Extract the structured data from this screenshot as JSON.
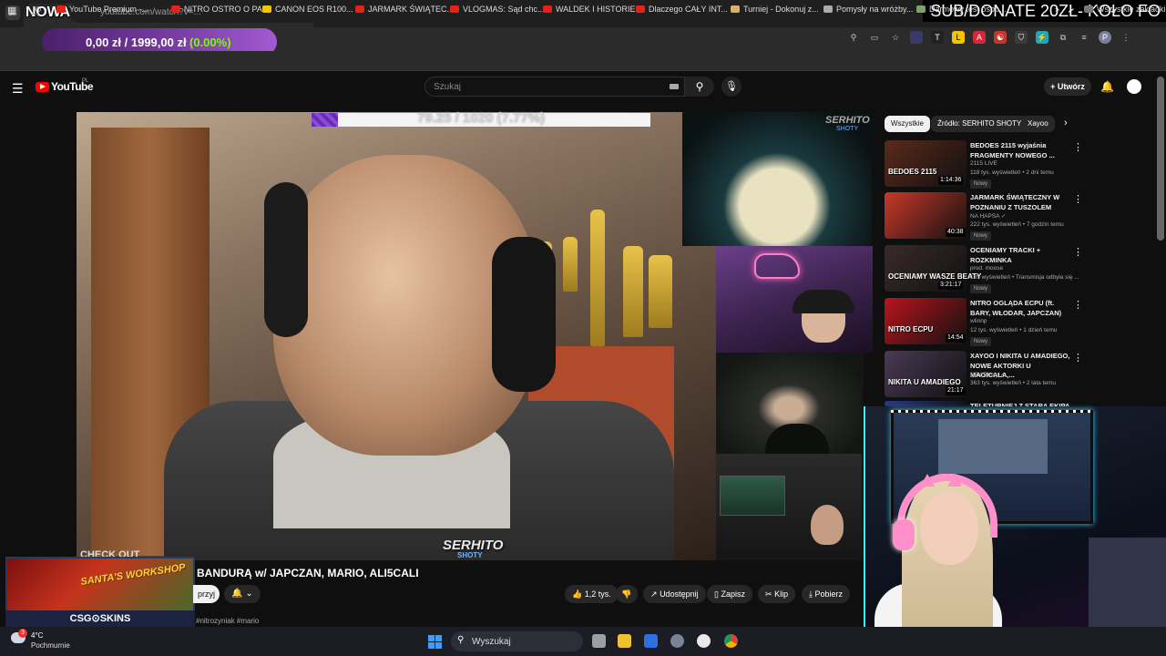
{
  "browser": {
    "tab_title": "NOWA KAMERKA DO STRIMOWANIA",
    "tab_menu": "⌄",
    "new_tab": "+",
    "close": "✕",
    "url_partial": "youtube.com/watch?v=...",
    "bookmarks": [
      {
        "label": "YouTube Premium -...",
        "color": "#e62117"
      },
      {
        "label": "NITRO OSTRO O PA...",
        "color": "#e62117"
      },
      {
        "label": "CANON EOS R100...",
        "color": "#f5c400"
      },
      {
        "label": "JARMARK ŚWIĄTEC...",
        "color": "#e62117"
      },
      {
        "label": "VLOGMAS: Sąd chc...",
        "color": "#e62117"
      },
      {
        "label": "WALDEK I HISTORIE...",
        "color": "#e62117"
      },
      {
        "label": "Dlaczego CAŁY INT...",
        "color": "#e62117"
      },
      {
        "label": "Turniej - Dokonuj z...",
        "color": "#d6b06a"
      },
      {
        "label": "Pomysły na wróżby...",
        "color": "#aaaaaa"
      },
      {
        "label": "Darmowy test osob...",
        "color": "#7aa36a"
      }
    ],
    "all_bookmarks": "Wszystkie zakładki"
  },
  "overlays": {
    "donate": "SUB/DONATE 20ZŁ- KOŁO FO",
    "price_value": "0,00 zł / 1999,00 zł",
    "price_pct": "(0.00%)",
    "goal_progress_text": "79.25 / 1020 (7.77%)",
    "goal_fraction": 0.0777,
    "check_out": "CHECK OUT",
    "csg_banner": "SANTA'S WORKSHOP",
    "csg_brand": "CSG⊙SKINS",
    "watermark": "SERHITO",
    "watermark_sub": "SHOTY",
    "cam_watermark": "SERHITO",
    "cam_watermark_sub": "SHOTY"
  },
  "youtube": {
    "logo_text": "YouTube",
    "logo_region": "PL",
    "search_placeholder": "Szukaj",
    "create_label": "Utwórz",
    "video_title": "BANDURĄ w/ JAPCZAN, MARIO, ALI5CALI",
    "subscribe_label": "przyj",
    "actions": {
      "likes": "1,2 tys.",
      "share": "Udostępnij",
      "save": "Zapisz",
      "clip": "Klip",
      "download": "Pobierz"
    },
    "description_tags": "#nitrozyniak #mario"
  },
  "sidebar": {
    "chips": [
      "Wszystkie",
      "Źródło: SERHITO SHOTY",
      "Xayoo"
    ],
    "recommendations": [
      {
        "title": "BEDOES 2115 wyjaśnia FRAGMENTY NOWEGO ...",
        "channel": "2115 LIVE",
        "meta": "118 tys. wyświetleń • 2 dni temu",
        "duration": "1:14:36",
        "badge": "Nowy",
        "thumb_caption": "BEDOES 2115",
        "thumb_color": "#5a2a1a"
      },
      {
        "title": "JARMARK ŚWIĄTECZNY W POZNANIU Z TUSZOLEM",
        "channel": "NA HAPSA ✓",
        "meta": "222 tys. wyświetleń • 7 godzin temu",
        "duration": "40:38",
        "badge": "Nowy",
        "thumb_caption": "",
        "thumb_color": "#c9382a"
      },
      {
        "title": "OCENIAMY TRACKI + ROZKMINKA",
        "channel": "prod. moose",
        "meta": "139 wyświetleń • Transmisja odbyła się ...",
        "duration": "3:21:17",
        "badge": "Nowy",
        "thumb_caption": "OCENIAMY WASZE BEATY",
        "thumb_color": "#3a2a2a"
      },
      {
        "title": "NITRO OGLĄDA ECPU (ft. BARY, WŁODAR, JAPCZAN)",
        "channel": "wlinnp",
        "meta": "12 tys. wyświetleń • 1 dzień temu",
        "duration": "14:54",
        "badge": "Nowy",
        "thumb_caption": "NITRO ECPU",
        "thumb_color": "#b8141c"
      },
      {
        "title": "XAYOO I NIKITA U AMADIEGO, NOWE AKTORKI U MAGICALA,...",
        "channel": "NJN Shoty ✓",
        "meta": "363 tys. wyświetleń • 2 lata temu",
        "duration": "21:17",
        "badge": "",
        "thumb_caption": "NIKITA U AMADIEGO",
        "thumb_color": "#4a3a55"
      },
      {
        "title": "TELETURNIEJ Z STARA EKIPA",
        "channel": "",
        "meta": "",
        "duration": "",
        "badge": "",
        "thumb_caption": "",
        "thumb_color": "#2a3a8a"
      }
    ]
  },
  "taskbar": {
    "temp": "4°C",
    "condition": "Pochmurnie",
    "weather_badge": "3",
    "search_label": "Wyszukaj"
  }
}
